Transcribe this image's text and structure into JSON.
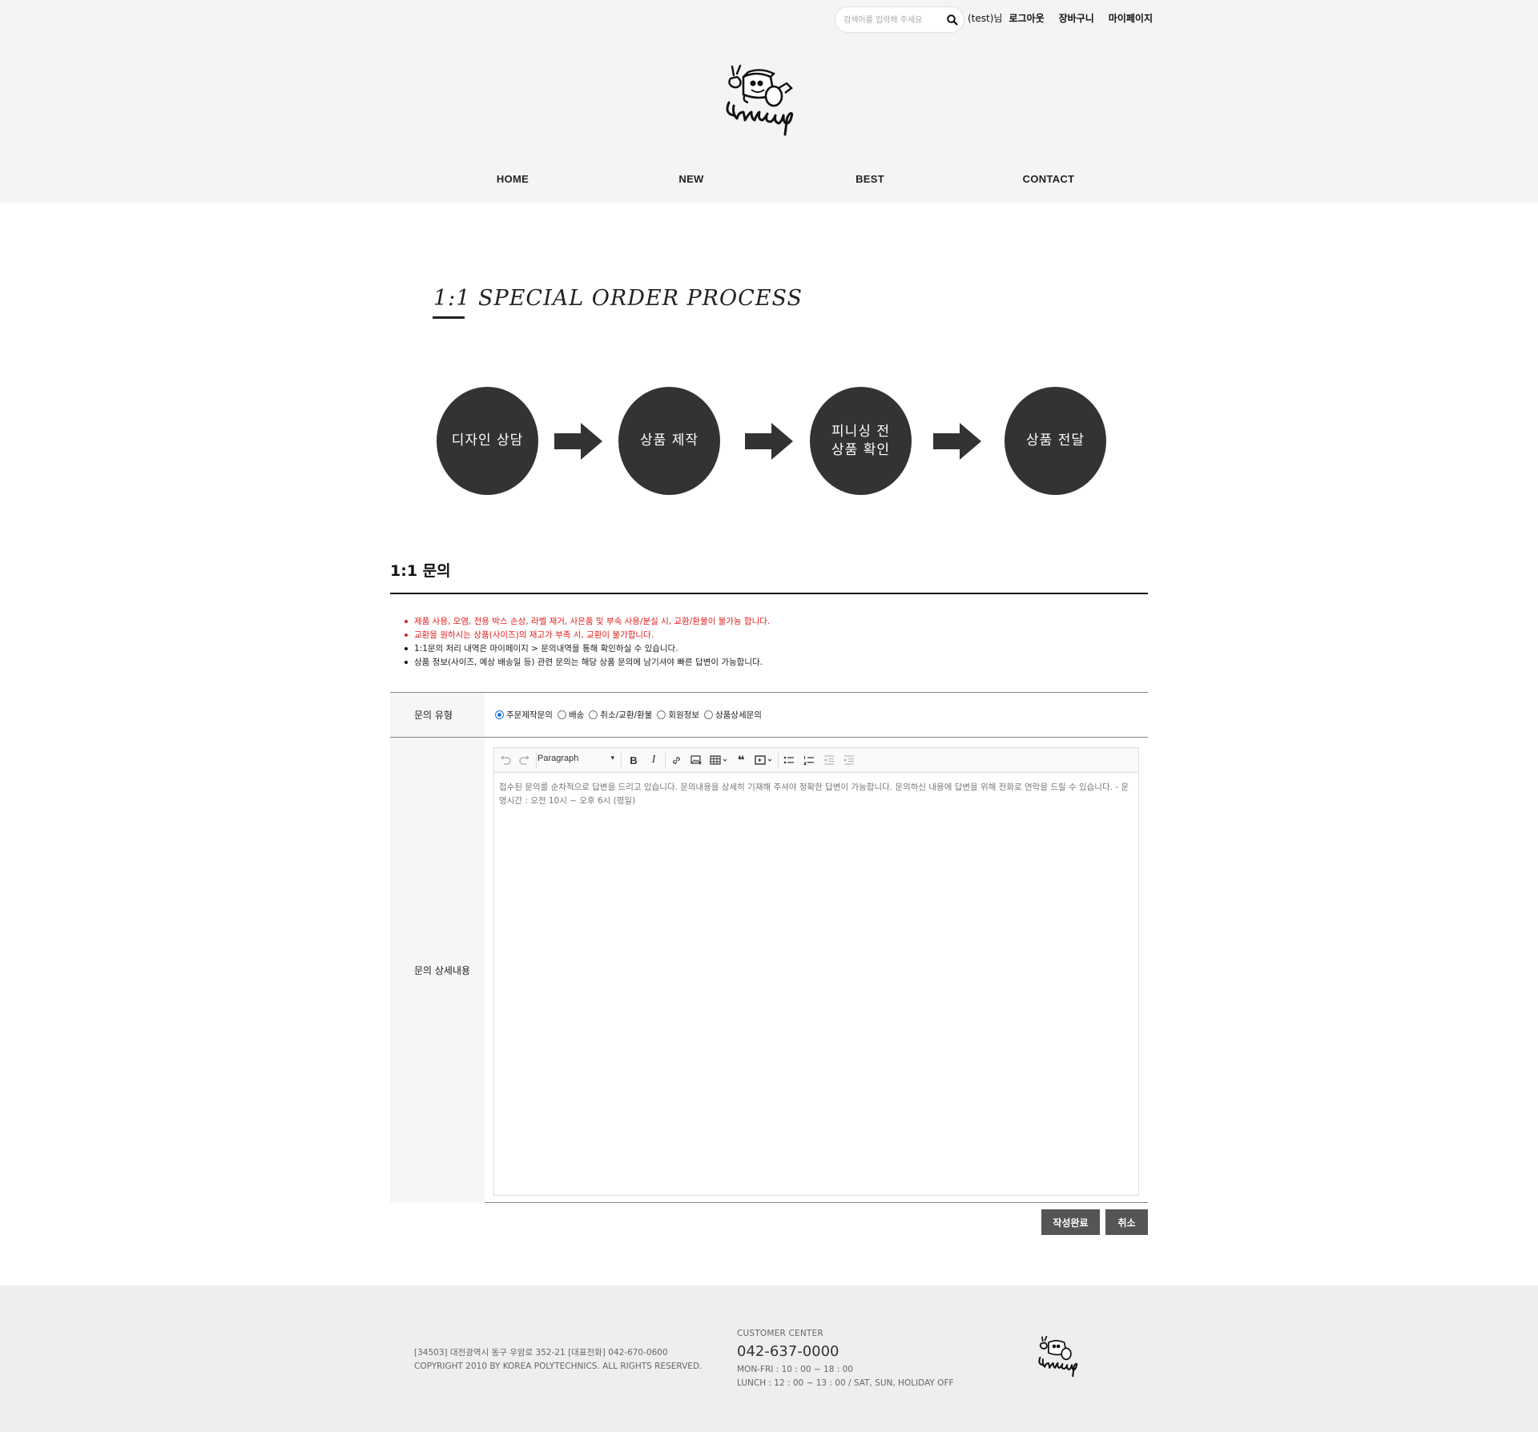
{
  "header": {
    "search": {
      "placeholder": "검색어를 입력해 주세요"
    },
    "user_label": "(test)님",
    "links": {
      "logout": "로그아웃",
      "cart": "장바구니",
      "mypage": "마이페이지"
    }
  },
  "nav": {
    "items": [
      "HOME",
      "NEW",
      "BEST",
      "CONTACT"
    ]
  },
  "process": {
    "title": "1:1 SPECIAL ORDER PROCESS",
    "steps": [
      "디자인 상담",
      "상품 제작",
      "피니싱 전\n상품 확인",
      "상품 전달"
    ]
  },
  "inquiry": {
    "title": "1:1 문의",
    "notes": [
      "제품 사용, 오염, 전용 박스 손상, 라벨 제거, 사은품 및 부속 사용/분실 시, 교환/환불이 불가능 합니다.",
      "교환을 원하시는 상품(사이즈)의 재고가 부족 시, 교환이 불가합니다.",
      "1:1문의 처리 내역은 마이페이지 > 문의내역을 통해 확인하실 수 있습니다.",
      "상품 정보(사이즈, 예상 배송일 등) 관련 문의는 해당 상품 문의에 남기셔야 빠른 답변이 가능합니다."
    ],
    "type_label": "문의 유형",
    "types": [
      "주문제작문의",
      "배송",
      "취소/교환/환불",
      "회원정보",
      "상품상세문의"
    ],
    "selected_type": "주문제작문의",
    "detail_label": "문의 상세내용",
    "editor": {
      "format": "Paragraph",
      "placeholder": "접수된 문의를 순차적으로 답변을 드리고 있습니다. 문의내용을 상세히 기재해 주셔야 정확한 답변이 가능합니다. 문의하신 내용에 답변을 위해 전화로 연락을 드릴 수 있습니다. - 운영시간 : 오전 10시 ~ 오후 6시 (평일)"
    },
    "submit": "작성완료",
    "cancel": "취소"
  },
  "footer": {
    "address": "[34503] 대전광역시 동구 우암로 352-21 [대표전화] 042-670-0600",
    "copyright": "COPYRIGHT 2010 BY KOREA POLYTECHNICS. ALL RIGHTS RESERVED.",
    "center_label": "CUSTOMER CENTER",
    "phone": "042-637-0000",
    "hours": "MON-FRI : 10 : 00 ~ 18 : 00",
    "lunch": "LUNCH : 12 : 00 ~ 13 : 00 / SAT, SUN, HOLIDAY OFF"
  },
  "colors": {
    "header_bg": "#f4f5f3",
    "step_circle": "#333333",
    "notice_red": "#e02020",
    "button": "#555555",
    "footer_bg": "#eeeeee"
  },
  "icons": [
    "search-icon",
    "undo-icon",
    "redo-icon",
    "bold-icon",
    "italic-icon",
    "link-icon",
    "image-upload-icon",
    "table-icon",
    "blockquote-icon",
    "media-embed-icon",
    "bulleted-list-icon",
    "numbered-list-icon",
    "outdent-icon",
    "indent-icon",
    "arrow-right-icon"
  ]
}
